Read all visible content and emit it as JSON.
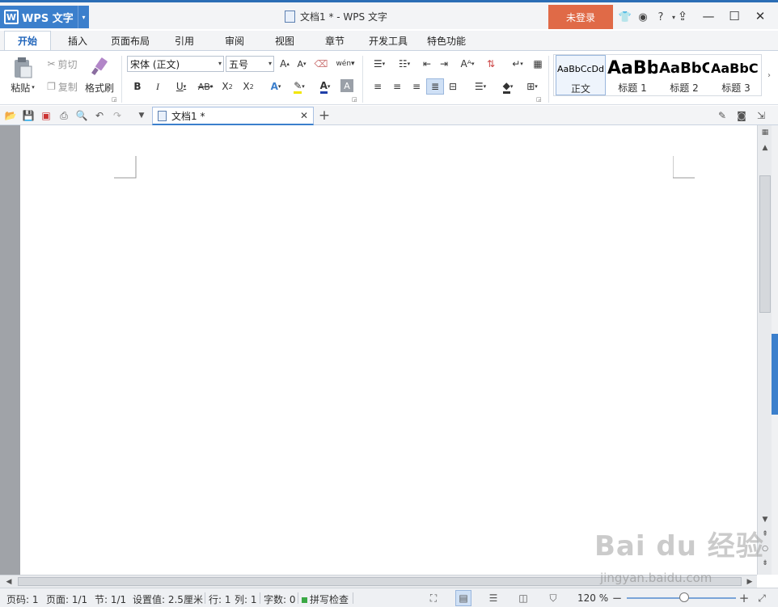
{
  "app": {
    "name": "WPS 文字",
    "dropdown": "▾"
  },
  "window": {
    "title": "文档1 * - WPS 文字",
    "login": "未登录",
    "help": "?",
    "minimize": "—",
    "maximize": "☐",
    "close": "✕"
  },
  "menu": [
    "开始",
    "插入",
    "页面布局",
    "引用",
    "审阅",
    "视图",
    "章节",
    "开发工具",
    "特色功能"
  ],
  "ribbon": {
    "paste": "粘贴",
    "cut": "剪切",
    "copy": "复制",
    "format_painter": "格式刷",
    "font": "宋体 (正文)",
    "size": "五号",
    "styles": [
      {
        "preview": "AaBbCcDd",
        "name": "正文"
      },
      {
        "preview": "AaBb",
        "name": "标题 1"
      },
      {
        "preview": "AaBbC",
        "name": "标题 2"
      },
      {
        "preview": "AaBbC",
        "name": "标题 3"
      }
    ]
  },
  "tabs": {
    "doc": "文档1 *",
    "new": "+"
  },
  "status": {
    "page": "页码: 1",
    "pages": "页面: 1/1",
    "section": "节: 1/1",
    "setting": "设置值: 2.5厘米",
    "row": "行: 1",
    "col": "列: 1",
    "words": "字数: 0",
    "spell": "拼写检查",
    "zoom": "120 %"
  },
  "watermark": {
    "brand": "Bai du 经验",
    "url": "jingyan.baidu.com"
  },
  "colors": {
    "accent": "#3b7fcc",
    "login": "#e06a47"
  }
}
